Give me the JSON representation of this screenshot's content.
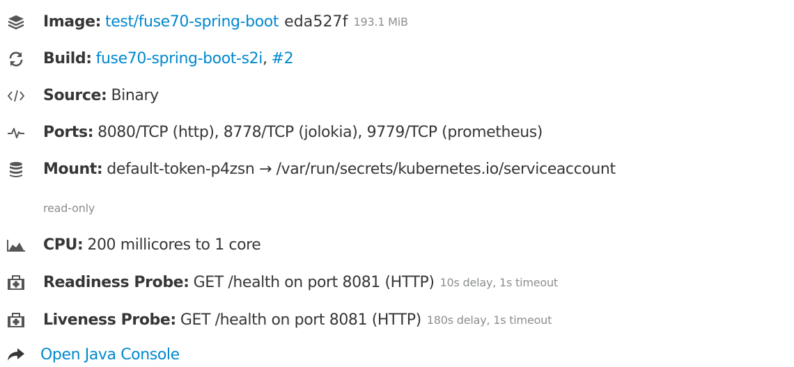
{
  "image": {
    "label": "Image:",
    "link": "test/fuse70-spring-boot",
    "id": "eda527f",
    "size": "193.1 MiB",
    "icon": "layers-icon"
  },
  "build": {
    "label": "Build:",
    "link": "fuse70-spring-boot-s2i",
    "sep": ",",
    "number": "#2",
    "icon": "refresh-icon"
  },
  "source": {
    "label": "Source:",
    "value": "Binary",
    "icon": "code-icon"
  },
  "ports": {
    "label": "Ports:",
    "value": "8080/TCP (http), 8778/TCP (jolokia), 9779/TCP (prometheus)",
    "icon": "pulse-icon"
  },
  "mount": {
    "label": "Mount:",
    "value": "default-token-p4zsn → /var/run/secrets/kubernetes.io/serviceaccount",
    "note": "read-only",
    "icon": "database-icon"
  },
  "cpu": {
    "label": "CPU:",
    "value": "200 millicores to 1 core",
    "icon": "area-chart-icon"
  },
  "readiness": {
    "label": "Readiness Probe:",
    "value": "GET /health on port 8081 (HTTP)",
    "note": "10s delay, 1s timeout",
    "icon": "medkit-icon"
  },
  "liveness": {
    "label": "Liveness Probe:",
    "value": "GET /health on port 8081 (HTTP)",
    "note": "180s delay, 1s timeout",
    "icon": "medkit-icon"
  },
  "console": {
    "label": "Open Java Console",
    "icon": "share-arrow-icon"
  },
  "colors": {
    "link": "#0088ce",
    "text": "#363636",
    "muted": "#8b8d8f",
    "icon": "#555555"
  }
}
